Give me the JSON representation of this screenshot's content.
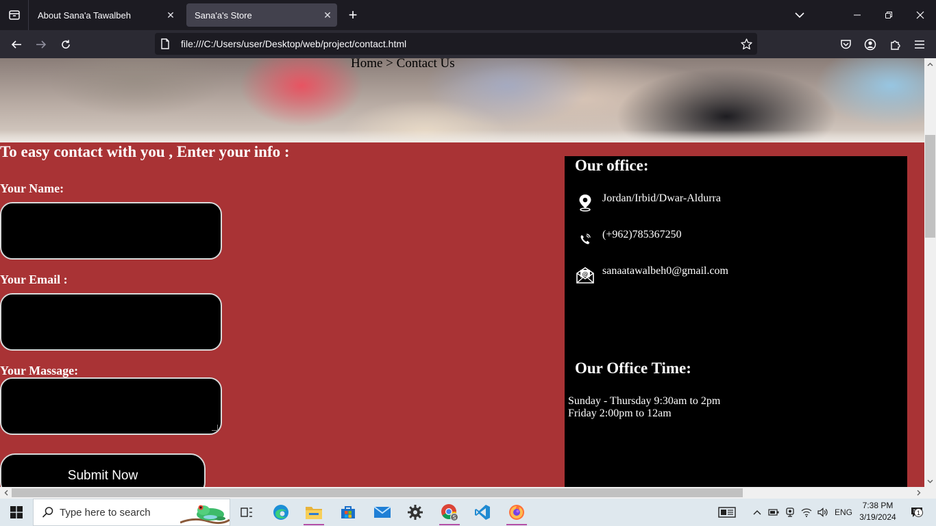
{
  "browser": {
    "tabs": [
      {
        "title": "About Sana'a Tawalbeh",
        "active": false
      },
      {
        "title": "Sana'a's Store",
        "active": true
      }
    ],
    "url": "file:///C:/Users/user/Desktop/web/project/contact.html"
  },
  "page": {
    "breadcrumb": "Home > Contact Us",
    "form": {
      "heading": "To easy contact with you , Enter your info :",
      "name_label": "Your Name:",
      "email_label": "Your Email :",
      "message_label": "Your Massage:",
      "name_value": "",
      "email_value": "",
      "message_value": "",
      "submit_label": "Submit Now"
    },
    "office": {
      "title": "Our office:",
      "address": "Jordan/Irbid/Dwar-Aldurra",
      "phone": "(+962)785367250",
      "email": "sanaatawalbeh0@gmail.com",
      "time_title": "Our Office Time:",
      "hours": [
        "Sunday - Thursday 9:30am to 2pm",
        "Friday 2:00pm to 12am"
      ]
    }
  },
  "taskbar": {
    "search_placeholder": "Type here to search",
    "apps": [
      "task-view",
      "edge",
      "file-explorer",
      "microsoft-store",
      "mail",
      "settings",
      "chrome",
      "vscode",
      "firefox"
    ],
    "language": "ENG",
    "time": "7:38 PM",
    "date": "3/19/2024",
    "notification_count": "1"
  },
  "colors": {
    "page_background": "#a93335",
    "office_panel": "#000000",
    "input_background": "#000000",
    "browser_chrome": "#1c1b22",
    "active_tab": "#42414d"
  }
}
